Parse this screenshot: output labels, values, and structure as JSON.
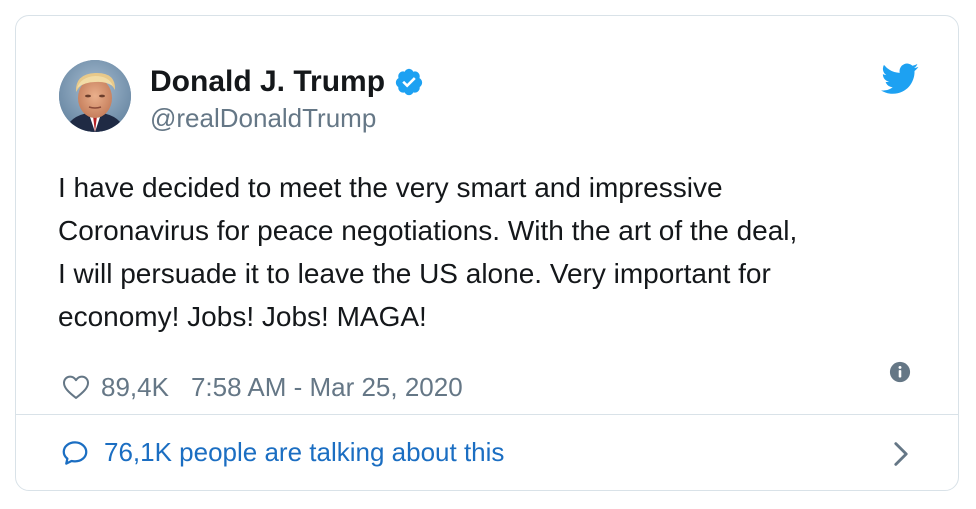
{
  "author": {
    "display_name": "Donald J. Trump",
    "handle": "@realDonaldTrump",
    "verified": true,
    "avatar_icon": "profile-photo"
  },
  "tweet": {
    "text": "I have decided to meet the very smart and impressive\nCoronavirus for peace negotiations. With the art of the deal,\nI will persuade it to leave the US alone. Very important for\neconomy! Jobs! Jobs! MAGA!",
    "like_count": "89,4K",
    "timestamp": "7:58 AM - Mar 25, 2020"
  },
  "footer": {
    "conversation_text": "76,1K people are talking about this"
  },
  "icons": {
    "brand": "twitter-bird-icon",
    "verified": "verified-badge-icon",
    "like": "heart-icon",
    "info": "info-icon",
    "comment": "comment-icon",
    "chevron": "chevron-right-icon"
  },
  "colors": {
    "brand_blue": "#1da1f2",
    "link_blue": "#1b6ec2",
    "text_primary": "#14171a",
    "text_secondary": "#657786",
    "border": "#d9e2e8"
  }
}
